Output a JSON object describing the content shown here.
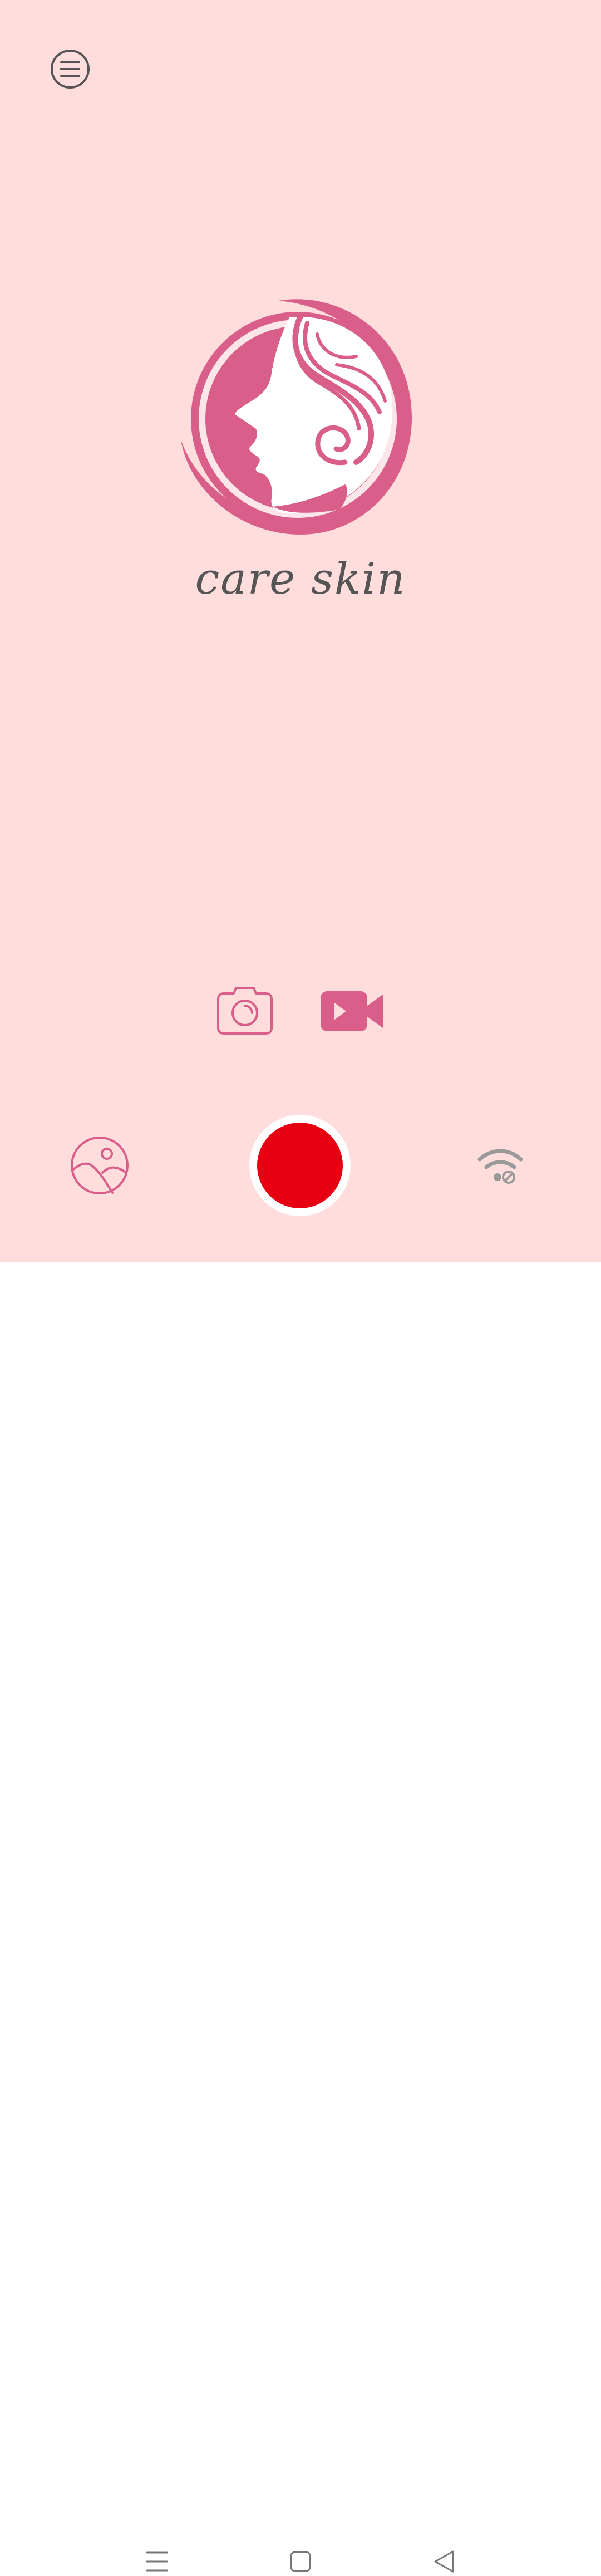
{
  "app": {
    "brand_name": "care skin"
  },
  "colors": {
    "background": "#FFDDDC",
    "accent": "#D95F8A",
    "shutter": "#E60012",
    "icon_gray": "#555555",
    "navbar": "#FFFFFF"
  },
  "icons": {
    "menu": "menu-icon",
    "photo_mode": "camera-icon",
    "video_mode": "video-camera-icon",
    "gallery": "gallery-icon",
    "wifi": "wifi-disconnected-icon"
  }
}
